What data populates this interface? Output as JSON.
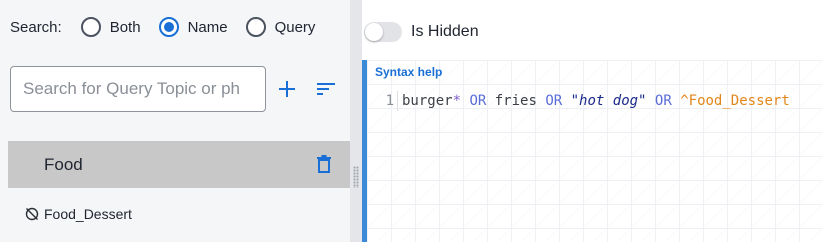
{
  "search": {
    "label": "Search:",
    "options": [
      {
        "label": "Both",
        "selected": false
      },
      {
        "label": "Name",
        "selected": true
      },
      {
        "label": "Query",
        "selected": false
      }
    ],
    "placeholder": "Search for Query Topic or ph",
    "value": ""
  },
  "actions": {
    "add_icon": "plus-icon",
    "sort_icon": "sort-icon",
    "delete_icon": "trash-icon"
  },
  "list": {
    "items": [
      {
        "label": "Food",
        "selected": true,
        "hidden": false
      },
      {
        "label": "Food_Dessert",
        "selected": false,
        "hidden": true
      }
    ]
  },
  "toggle": {
    "label": "Is Hidden",
    "checked": false
  },
  "editor": {
    "syntax_help": "Syntax help",
    "line_number": "1",
    "tokens": [
      {
        "text": "burger",
        "kind": "word"
      },
      {
        "text": "*",
        "kind": "op"
      },
      {
        "text": " ",
        "kind": "word"
      },
      {
        "text": "OR",
        "kind": "kw"
      },
      {
        "text": " fries ",
        "kind": "word"
      },
      {
        "text": "OR",
        "kind": "kw"
      },
      {
        "text": " ",
        "kind": "word"
      },
      {
        "text": "\"hot dog\"",
        "kind": "str"
      },
      {
        "text": " ",
        "kind": "word"
      },
      {
        "text": "OR",
        "kind": "kw"
      },
      {
        "text": " ",
        "kind": "word"
      },
      {
        "text": "^Food_Dessert",
        "kind": "ref"
      }
    ]
  },
  "colors": {
    "accent": "#1a6fd6",
    "selected_row": "#c8c8c8",
    "editor_border": "#3b8ad8",
    "keyword": "#5a6cd8",
    "reference": "#e2861a"
  }
}
